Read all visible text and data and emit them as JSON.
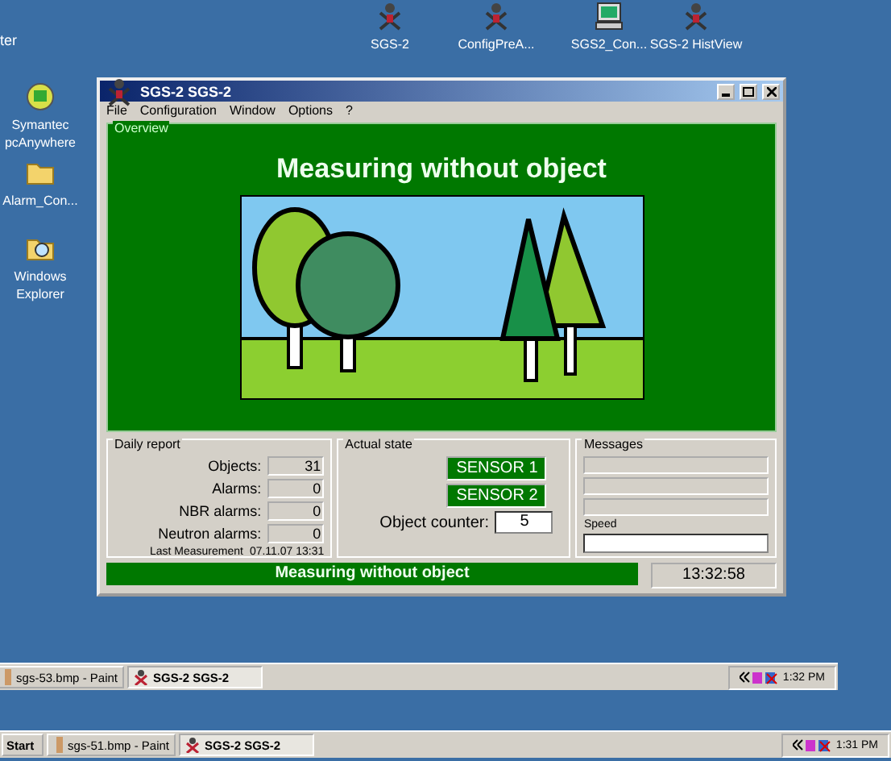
{
  "desktop_cut_text": "ter",
  "desktop_icons": [
    {
      "label": "Symantec pcAnywhere",
      "kind": "app"
    },
    {
      "label": "Alarm_Con...",
      "kind": "folder"
    },
    {
      "label": "Windows Explorer",
      "kind": "explorer"
    }
  ],
  "top_icons": [
    {
      "label": "SGS-2",
      "kind": "sgs"
    },
    {
      "label": "ConfigPreA...",
      "kind": "sgs"
    },
    {
      "label": "SGS2_Con...",
      "kind": "computer"
    },
    {
      "label": "SGS-2 HistView",
      "kind": "sgs"
    }
  ],
  "window": {
    "title": "SGS-2 SGS-2",
    "menu": [
      "File",
      "Configuration",
      "Window",
      "Options",
      "?"
    ],
    "overview": {
      "legend": "Overview",
      "heading": "Measuring without object"
    },
    "daily_report": {
      "legend": "Daily report",
      "rows": [
        {
          "label": "Objects:",
          "value": "31"
        },
        {
          "label": "Alarms:",
          "value": "0"
        },
        {
          "label": "NBR alarms:",
          "value": "0"
        },
        {
          "label": "Neutron alarms:",
          "value": "0"
        }
      ],
      "last_label": "Last Measurement",
      "last_value": "07.11.07 13:31"
    },
    "actual_state": {
      "legend": "Actual state",
      "sensors": [
        "SENSOR 1",
        "SENSOR 2"
      ],
      "counter_label": "Object counter:",
      "counter_value": "5"
    },
    "messages": {
      "legend": "Messages",
      "speed_label": "Speed"
    },
    "status": "Measuring without object",
    "time": "13:32:58"
  },
  "taskbars": [
    {
      "buttons": [
        {
          "label": "sgs-53.bmp - Paint",
          "kind": "paint",
          "selected": false
        },
        {
          "label": "SGS-2 SGS-2",
          "kind": "sgs",
          "selected": true
        }
      ],
      "clock": "1:32 PM"
    },
    {
      "start_label": "Start",
      "buttons": [
        {
          "label": "sgs-51.bmp - Paint",
          "kind": "paint",
          "selected": false
        },
        {
          "label": "SGS-2 SGS-2",
          "kind": "sgs",
          "selected": true
        }
      ],
      "clock": "1:31 PM"
    }
  ]
}
